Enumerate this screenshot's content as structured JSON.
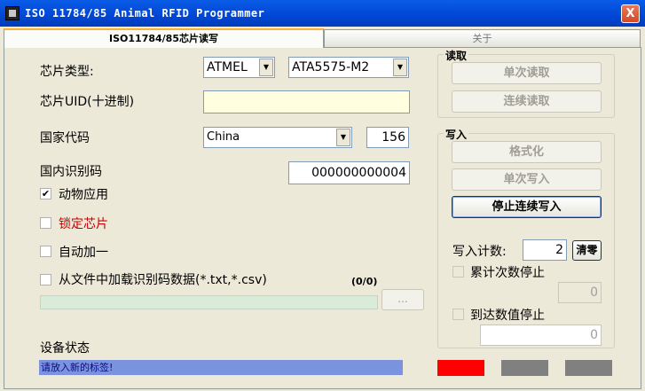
{
  "window": {
    "title": "ISO 11784/85 Animal RFID Programmer",
    "close_label": "X"
  },
  "tabs": [
    {
      "label": "ISO11784/85芯片读写"
    },
    {
      "label": "关于"
    }
  ],
  "form": {
    "chip_type_label": "芯片类型:",
    "chip_vendor": "ATMEL",
    "chip_model": "ATA5575-M2",
    "chip_uid_label": "芯片UID(十进制)",
    "chip_uid_value": "",
    "country_code_label": "国家代码",
    "country": "China",
    "country_code": "156",
    "national_id_label": "国内识别码",
    "national_id_value": "000000000004",
    "animal_app": {
      "label": "动物应用",
      "checked": true,
      "mark": "✔"
    },
    "lock_chip": {
      "label": "锁定芯片",
      "checked": false,
      "color": "#cc0000"
    },
    "auto_increment": {
      "label": "自动加一",
      "checked": false
    },
    "load_file": {
      "label": "从文件中加载识别码数据(*.txt,*.csv)",
      "checked": false
    },
    "file_counter": "(0/0)",
    "browse_label": "..."
  },
  "read_group": {
    "title": "读取",
    "single_read": "单次读取",
    "continuous_read": "连续读取"
  },
  "write_group": {
    "title": "写入",
    "format": "格式化",
    "single_write": "单次写入",
    "stop_continuous_write": "停止连续写入",
    "write_count_label": "写入计数:",
    "write_count_value": "2",
    "clear_label": "清零",
    "stop_by_count": {
      "label": "累计次数停止",
      "value": "0"
    },
    "stop_by_value": {
      "label": "到达数值停止",
      "value": "0"
    }
  },
  "status": {
    "label": "设备状态",
    "message": "请放入新的标签!",
    "indicators": [
      {
        "name": "red",
        "color": "#ff0000"
      },
      {
        "name": "gray-1",
        "color": "#808080"
      },
      {
        "name": "gray-2",
        "color": "#808080"
      }
    ]
  },
  "icons": {
    "dropdown": "▼",
    "checkmark": "✔"
  }
}
